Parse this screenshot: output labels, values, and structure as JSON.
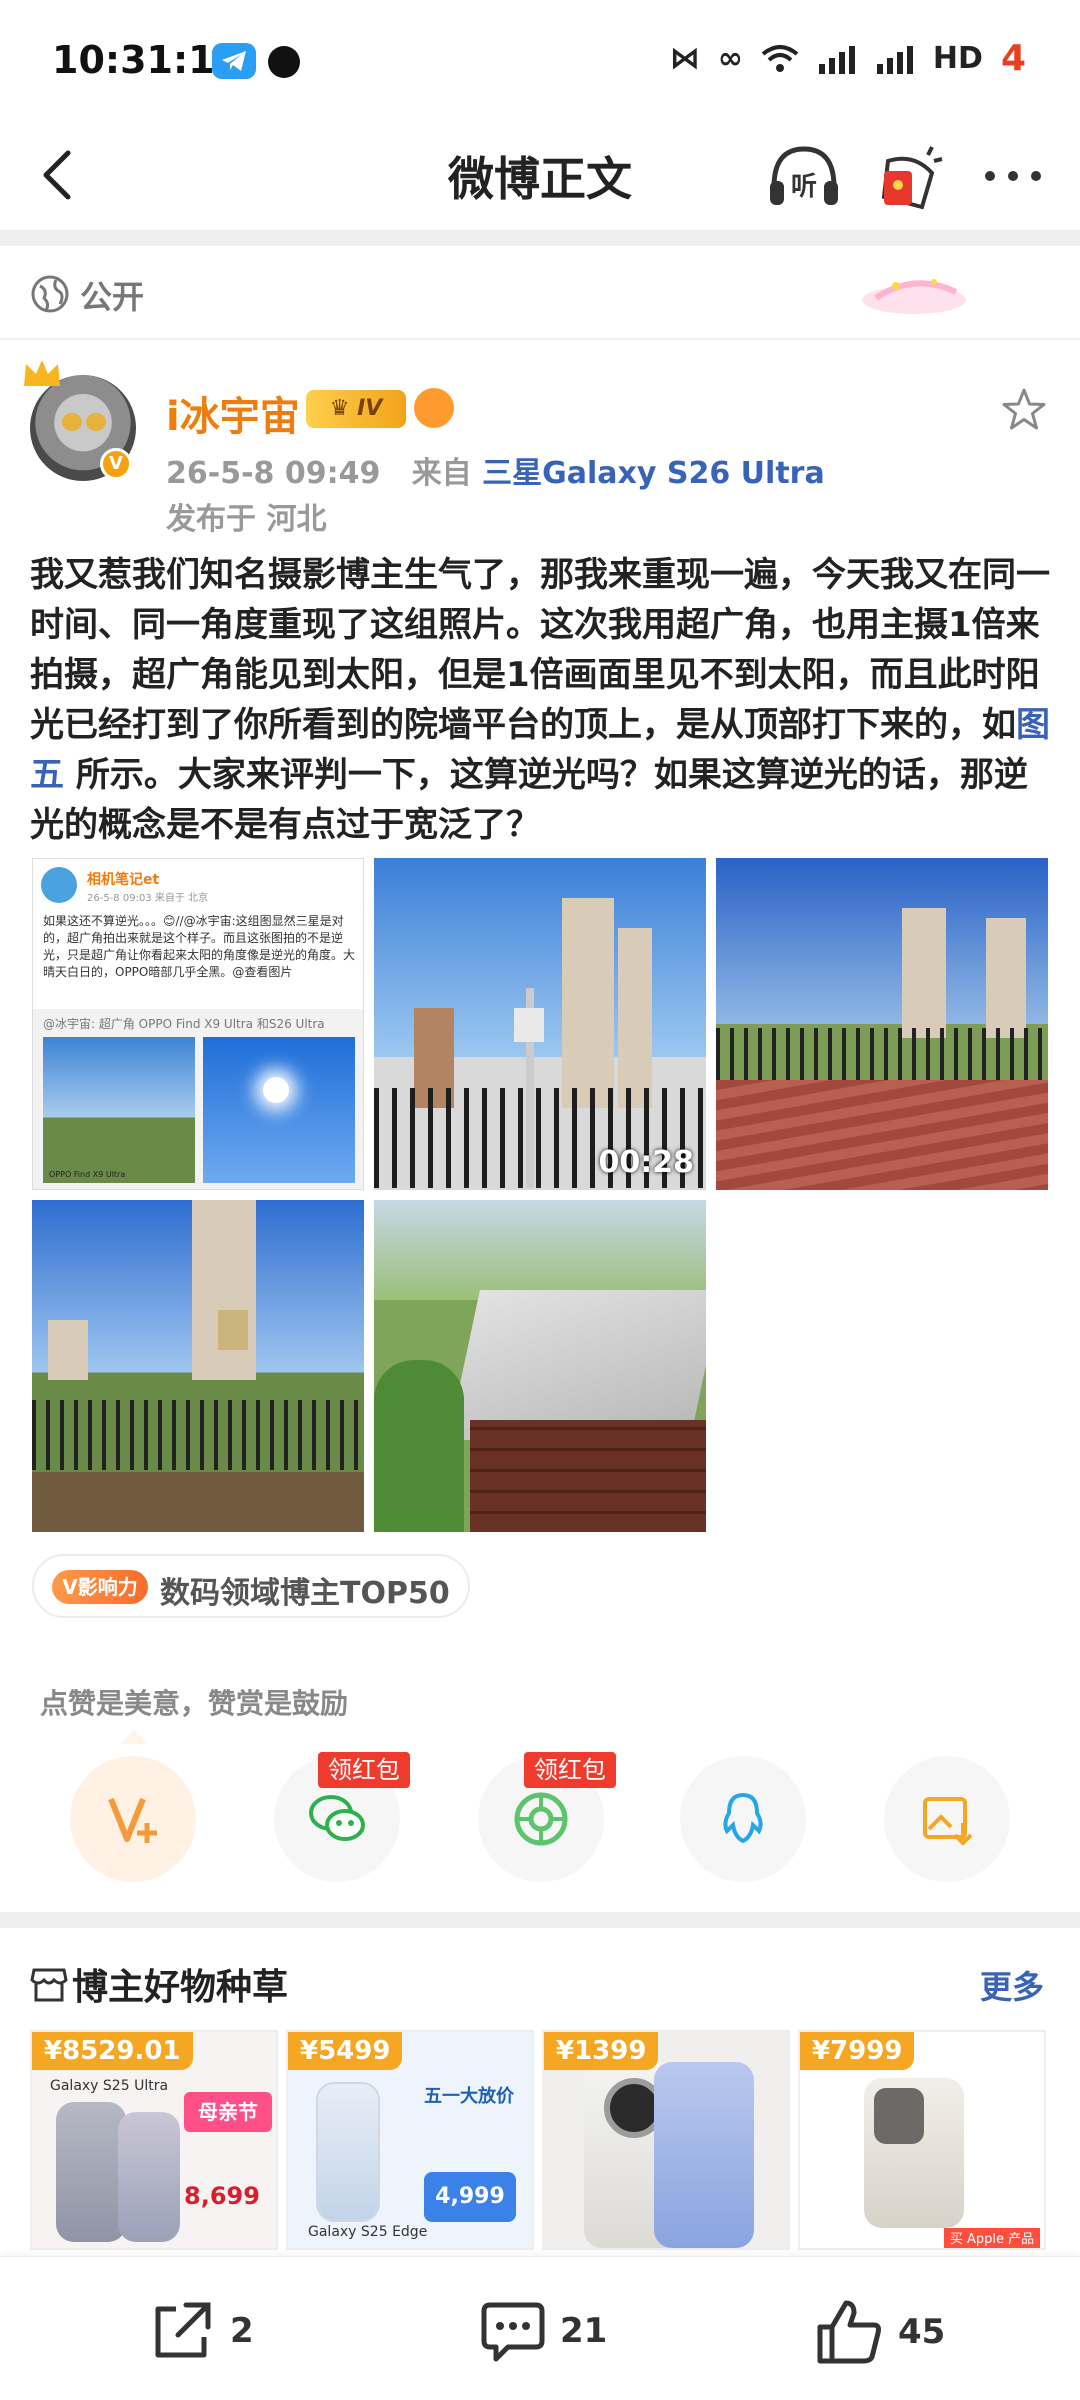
{
  "status_bar": {
    "time": "10:31:11",
    "network": "HD",
    "battery": "4"
  },
  "nav": {
    "title": "微博正文"
  },
  "visibility": {
    "label": "公开"
  },
  "post": {
    "username": "i冰宇宙",
    "level_badge": "IV",
    "meta_date": "26-5-8 09:49",
    "meta_from": "来自",
    "meta_source": "三星Galaxy S26 Ultra",
    "location": "发布于 河北",
    "text_before_link": "我又惹我们知名摄影博主生气了，那我来重现一遍，今天我又在同一时间、同一角度重现了这组照片。这次我用超广角，也用主摄1倍来拍摄，超广角能见到太阳，但是1倍画面里见不到太阳，而且此时阳光已经打到了你所看到的院墙平台的顶上，是从顶部打下来的，如",
    "text_link": "图五",
    "text_after_link": " 所示。大家来评判一下，这算逆光吗？如果这算逆光的话，那逆光的概念是不是有点过于宽泛了？",
    "video_duration": "00:28",
    "screenshot_lines": [
      "相机笔记et",
      "26-5-8 09:03  来自于 北京",
      "如果这还不算逆光。。。😊//@冰宇宙:这组图显然三星是对的，超广角拍出来就是这个样子。而且这张图拍的不是逆光，只是超广角让你看起来太阳的角度像是逆光的角度。大晴天白日的，OPPO暗部几乎全黑。@查看图片",
      "@冰宇宙: 超广角 OPPO Find X9 Ultra 和S26 Ultra",
      "OPPO Find X9 Ultra"
    ]
  },
  "influence": {
    "badge": "V影响力",
    "text": "数码领域博主TOP50"
  },
  "reward": {
    "hint": "点赞是美意，赞赏是鼓励",
    "red_packet": "领红包"
  },
  "recommend": {
    "title": "博主好物种草",
    "more": "更多",
    "cards": [
      {
        "price": "¥8529.01",
        "name": "Galaxy S25 Ultra",
        "promo": "母亲节",
        "deal": "8,699"
      },
      {
        "price": "¥5499",
        "name": "Galaxy S25 Edge",
        "promo": "五一大放价",
        "deal": "4,999"
      },
      {
        "price": "¥1399",
        "name": "",
        "promo": "",
        "deal": ""
      },
      {
        "price": "¥7999",
        "name": "",
        "promo": "买 Apple 产品",
        "deal": ""
      }
    ]
  },
  "bottom_bar": {
    "share_count": "2",
    "comment_count": "21",
    "like_count": "45"
  },
  "colors": {
    "accent_orange": "#ef7d0e",
    "link_blue": "#3863b8",
    "red": "#ef3b2d"
  }
}
